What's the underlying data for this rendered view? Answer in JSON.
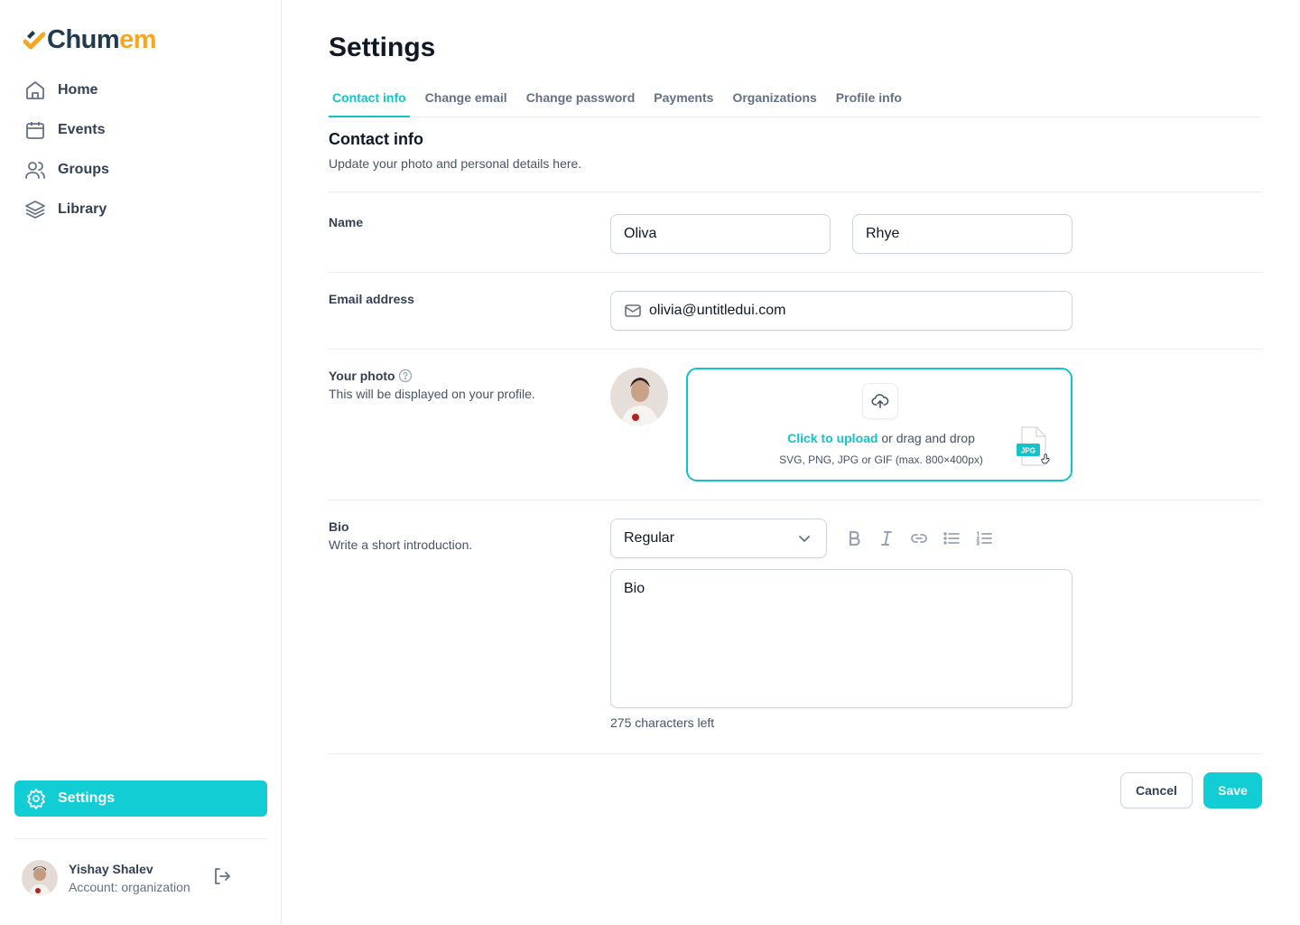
{
  "app": {
    "brand_part1": "Chum",
    "brand_part2": "em",
    "brand_color": "#1f3b4d",
    "brand_accent": "#f5a623",
    "accent": "#13cdd4"
  },
  "sidebar": {
    "items": [
      {
        "label": "Home",
        "icon": "home-icon"
      },
      {
        "label": "Events",
        "icon": "calendar-icon"
      },
      {
        "label": "Groups",
        "icon": "users-icon"
      },
      {
        "label": "Library",
        "icon": "layers-icon"
      }
    ],
    "settings_label": "Settings",
    "settings_icon": "gear-icon",
    "account": {
      "name": "Yishay Shalev",
      "type": "Account: organization"
    }
  },
  "page": {
    "title": "Settings",
    "tabs": [
      {
        "label": "Contact info",
        "active": true
      },
      {
        "label": "Change email",
        "active": false
      },
      {
        "label": "Change password",
        "active": false
      },
      {
        "label": "Payments",
        "active": false
      },
      {
        "label": "Organizations",
        "active": false
      },
      {
        "label": "Profile info",
        "active": false
      }
    ],
    "section_title": "Contact info",
    "section_subtitle": "Update your photo and personal details here."
  },
  "form": {
    "name_label": "Name",
    "first_name": "Oliva",
    "last_name": "Rhye",
    "email_label": "Email address",
    "email": "olivia@untitledui.com",
    "photo_label": "Your photo",
    "photo_sub": "This will be displayed on your profile.",
    "upload_link": "Click to upload",
    "upload_rest": " or drag and drop",
    "upload_hint": "SVG, PNG, JPG or GIF (max. 800×400px)",
    "file_badge": "JPG",
    "bio_label": "Bio",
    "bio_sub": "Write a short introduction.",
    "text_style": "Regular",
    "bio_value": "Bio",
    "chars_left": "275 characters left"
  },
  "actions": {
    "cancel": "Cancel",
    "save": "Save"
  }
}
